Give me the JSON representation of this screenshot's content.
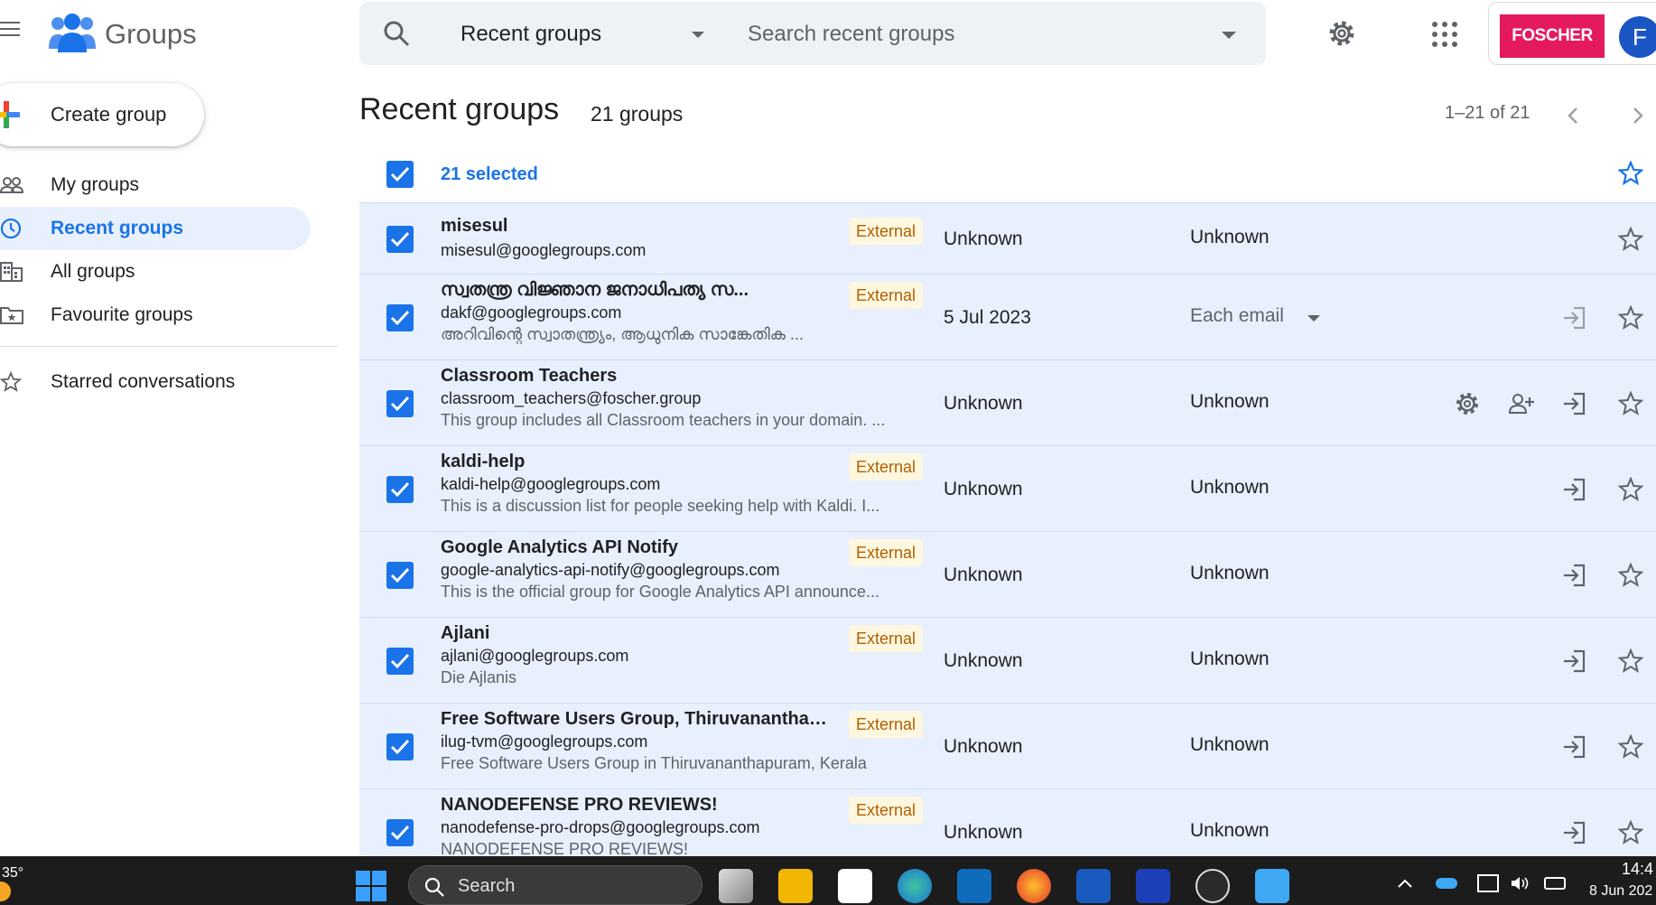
{
  "app": {
    "title": "Groups",
    "colors": {
      "accent": "#1a73e8",
      "selected_row": "#e8f0fe",
      "external_badge_bg": "#fef7e0",
      "external_badge_text": "#b06000",
      "brand": "#e5195e"
    }
  },
  "search": {
    "scope": "Recent groups",
    "placeholder": "Search recent groups"
  },
  "account": {
    "org_logo": "FOSCHER",
    "avatar_letter": "F"
  },
  "sidebar": {
    "create_label": "Create group",
    "items": [
      {
        "label": "My groups",
        "icon": "people-icon",
        "active": false
      },
      {
        "label": "Recent groups",
        "icon": "clock-icon",
        "active": true
      },
      {
        "label": "All groups",
        "icon": "building-icon",
        "active": false
      },
      {
        "label": "Favourite groups",
        "icon": "star-folder-icon",
        "active": false
      }
    ],
    "starred_label": "Starred conversations"
  },
  "main": {
    "title": "Recent groups",
    "count": "21 groups",
    "pagination": "1–21 of 21",
    "selected_label": "21 selected"
  },
  "groups": [
    {
      "name": "misesul",
      "email": "misesul@googlegroups.com",
      "desc": "",
      "external": "External",
      "col1": "Unknown",
      "col2": "Unknown"
    },
    {
      "name": "സ്വതന്ത്ര വിജ്ഞാന ജനാധിപത്യ സ...",
      "email": "dakf@googlegroups.com",
      "desc": "അറിവിന്റെ സ്വാതന്ത്ര്യം, ആധുനിക സാങ്കേതിക ...",
      "external": "External",
      "col1": "5 Jul 2023",
      "col2": "Each email"
    },
    {
      "name": "Classroom Teachers",
      "email": "classroom_teachers@foscher.group",
      "desc": "This group includes all Classroom teachers in your domain. ...",
      "external": "",
      "col1": "Unknown",
      "col2": "Unknown"
    },
    {
      "name": "kaldi-help",
      "email": "kaldi-help@googlegroups.com",
      "desc": "This is a discussion list for people seeking help with Kaldi. I...",
      "external": "External",
      "col1": "Unknown",
      "col2": "Unknown"
    },
    {
      "name": "Google Analytics API Notify",
      "email": "google-analytics-api-notify@googlegroups.com",
      "desc": "This is the official group for Google Analytics API announce...",
      "external": "External",
      "col1": "Unknown",
      "col2": "Unknown"
    },
    {
      "name": "Ajlani",
      "email": "ajlani@googlegroups.com",
      "desc": "Die Ajlanis",
      "external": "External",
      "col1": "Unknown",
      "col2": "Unknown"
    },
    {
      "name": "Free Software Users Group, Thiruvananthapur...",
      "email": "ilug-tvm@googlegroups.com",
      "desc": "Free Software Users Group in Thiruvananthapuram, Kerala",
      "external": "External",
      "col1": "Unknown",
      "col2": "Unknown"
    },
    {
      "name": "NANODEFENSE PRO REVIEWS!",
      "email": "nanodefense-pro-drops@googlegroups.com",
      "desc": "NANODEFENSE PRO REVIEWS!",
      "external": "External",
      "col1": "Unknown",
      "col2": "Unknown"
    }
  ],
  "taskbar": {
    "weather": "35°",
    "search_label": "Search",
    "time": "14:4",
    "date": "8 Jun 202"
  }
}
